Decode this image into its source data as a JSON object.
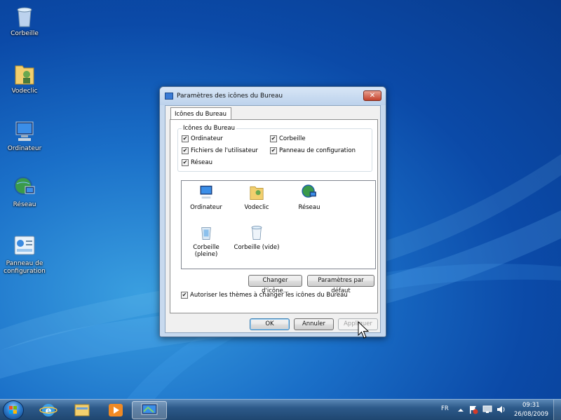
{
  "desktop": {
    "icons": [
      {
        "label": "Corbeille",
        "icon": "recycle-bin-icon"
      },
      {
        "label": "Vodeclic",
        "icon": "user-folder-icon"
      },
      {
        "label": "Ordinateur",
        "icon": "computer-icon"
      },
      {
        "label": "Réseau",
        "icon": "network-icon"
      },
      {
        "label": "Panneau de configuration",
        "icon": "control-panel-icon"
      }
    ]
  },
  "dialog": {
    "title": "Paramètres des icônes du Bureau",
    "close": "✕",
    "tab": "Icônes du Bureau",
    "group_title": "Icônes du Bureau",
    "checkboxes": [
      {
        "label": "Ordinateur",
        "checked": true
      },
      {
        "label": "Corbeille",
        "checked": true
      },
      {
        "label": "Fichiers de l'utilisateur",
        "checked": true
      },
      {
        "label": "Panneau de configuration",
        "checked": true
      },
      {
        "label": "Réseau",
        "checked": true
      }
    ],
    "icon_list": [
      {
        "label": "Ordinateur",
        "icon": "computer-icon"
      },
      {
        "label": "Vodeclic",
        "icon": "user-folder-icon"
      },
      {
        "label": "Réseau",
        "icon": "network-icon"
      },
      {
        "label": "Corbeille (pleine)",
        "icon": "recycle-bin-full-icon"
      },
      {
        "label": "Corbeille (vide)",
        "icon": "recycle-bin-empty-icon"
      }
    ],
    "change_icon_button": "Changer d'icône...",
    "default_button": "Paramètres par défaut",
    "allow_themes_label": "Autoriser les thèmes à changer les icônes du Bureau",
    "allow_themes_checked": true,
    "ok_button": "OK",
    "cancel_button": "Annuler",
    "apply_button": "Appliquer"
  },
  "taskbar": {
    "language": "FR",
    "time": "09:31",
    "date": "26/08/2009",
    "pinned": [
      "internet-explorer-icon",
      "explorer-folder-icon",
      "media-player-icon",
      "desktop-settings-icon"
    ]
  },
  "colors": {
    "desktop_blue": "#1a6fc8",
    "taskbar": "#2d5a8a",
    "close_red": "#c4422c"
  }
}
